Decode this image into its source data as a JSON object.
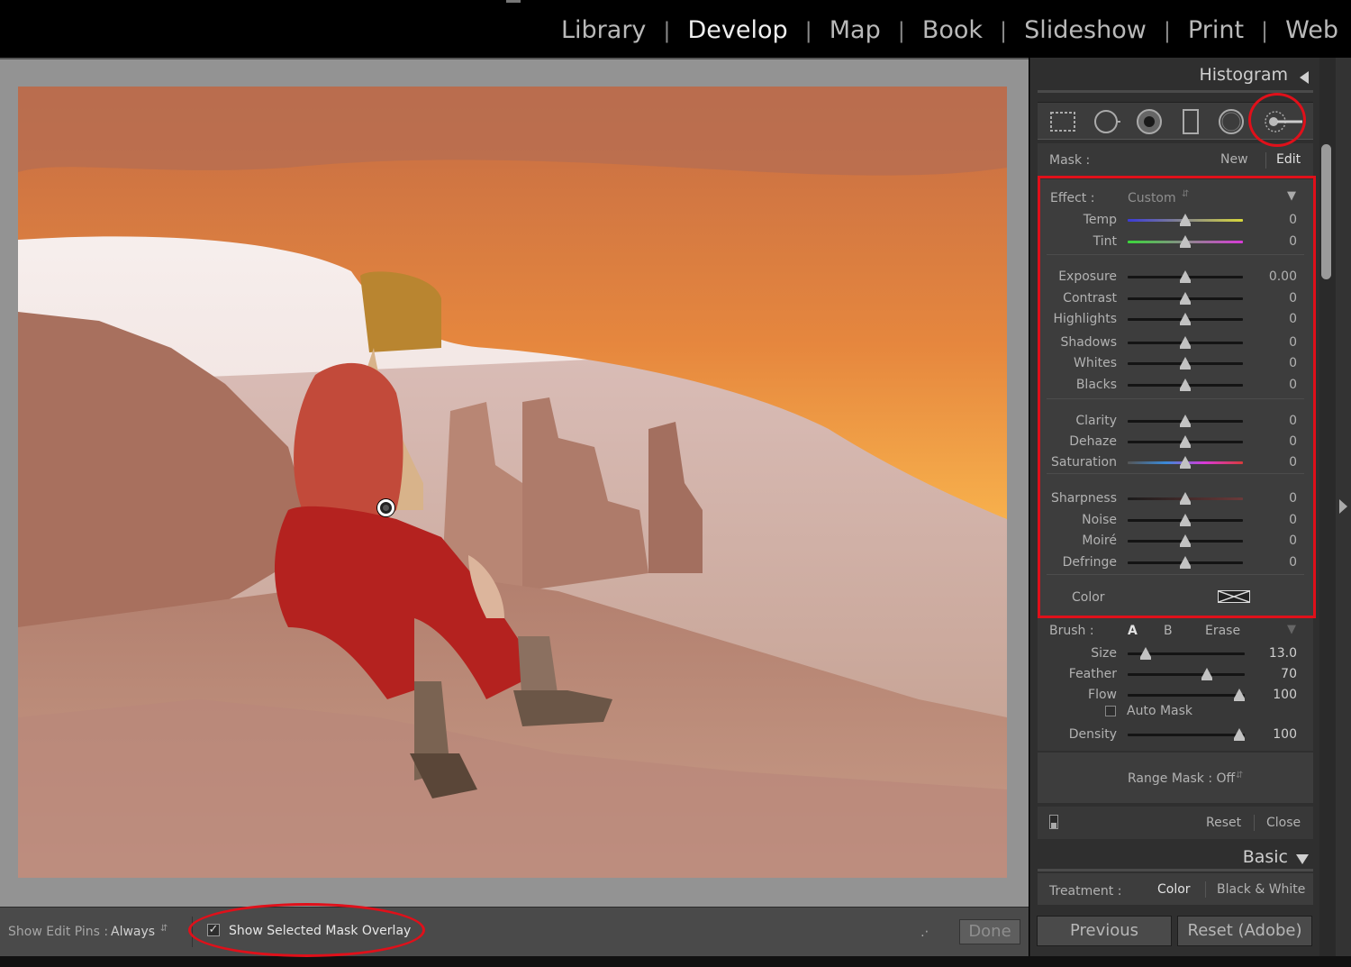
{
  "modules": [
    "Library",
    "Develop",
    "Map",
    "Book",
    "Slideshow",
    "Print",
    "Web"
  ],
  "active_module": "Develop",
  "panel": {
    "histogram_title": "Histogram",
    "tools": [
      "crop-overlay-icon",
      "spot-removal-icon",
      "red-eye-icon",
      "graduated-filter-icon",
      "radial-filter-icon",
      "adjustment-brush-icon"
    ],
    "mask": {
      "label": "Mask :",
      "new": "New",
      "edit": "Edit"
    },
    "effect": {
      "label": "Effect :",
      "preset": "Custom"
    },
    "sliders_wb": [
      {
        "label": "Temp",
        "value": "0"
      },
      {
        "label": "Tint",
        "value": "0"
      }
    ],
    "sliders_tone": [
      {
        "label": "Exposure",
        "value": "0.00"
      },
      {
        "label": "Contrast",
        "value": "0"
      },
      {
        "label": "Highlights",
        "value": "0"
      },
      {
        "label": "Shadows",
        "value": "0"
      },
      {
        "label": "Whites",
        "value": "0"
      },
      {
        "label": "Blacks",
        "value": "0"
      }
    ],
    "sliders_presence": [
      {
        "label": "Clarity",
        "value": "0"
      },
      {
        "label": "Dehaze",
        "value": "0"
      },
      {
        "label": "Saturation",
        "value": "0"
      }
    ],
    "sliders_detail": [
      {
        "label": "Sharpness",
        "value": "0"
      },
      {
        "label": "Noise",
        "value": "0"
      },
      {
        "label": "Moiré",
        "value": "0"
      },
      {
        "label": "Defringe",
        "value": "0"
      }
    ],
    "color_label": "Color",
    "brush": {
      "label": "Brush :",
      "a": "A",
      "b": "B",
      "erase": "Erase",
      "size": {
        "label": "Size",
        "value": "13.0",
        "level": 0.13
      },
      "feather": {
        "label": "Feather",
        "value": "70",
        "level": 0.7
      },
      "flow": {
        "label": "Flow",
        "value": "100",
        "level": 1.0
      },
      "auto_mask": "Auto Mask",
      "density": {
        "label": "Density",
        "value": "100",
        "level": 1.0
      }
    },
    "range_mask": "Range Mask : Off",
    "reset": "Reset",
    "close": "Close",
    "basic_title": "Basic",
    "treatment": {
      "label": "Treatment :",
      "color": "Color",
      "bw": "Black & White"
    },
    "previous": "Previous",
    "reset_adobe": "Reset (Adobe)"
  },
  "toolbar": {
    "show_edit_pins_label": "Show Edit Pins :",
    "show_edit_pins_value": "Always",
    "mask_overlay_label": "Show Selected Mask Overlay",
    "mask_overlay_checked": true,
    "done": "Done"
  },
  "colors": {
    "annotation": "#e0101a",
    "mask_overlay": "#d4141e"
  }
}
